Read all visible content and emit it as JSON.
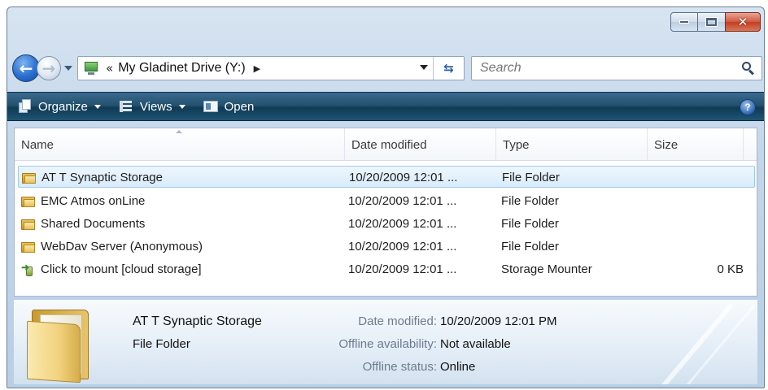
{
  "window": {
    "caption": {
      "minimize_icon": "minimize-icon",
      "maximize_icon": "maximize-icon",
      "close_glyph": "✕"
    }
  },
  "nav": {
    "location": "My Gladinet Drive (Y:)",
    "chevron": "«",
    "breadcrumb_arrow": "▶",
    "search_placeholder": "Search"
  },
  "toolbar": {
    "organize_label": "Organize",
    "views_label": "Views",
    "open_label": "Open",
    "help_label": "?"
  },
  "list": {
    "columns": [
      "Name",
      "Date modified",
      "Type",
      "Size"
    ],
    "rows": [
      {
        "name": "AT T Synaptic Storage",
        "date": "10/20/2009 12:01 ...",
        "type": "File Folder",
        "size": "",
        "icon": "folder-icon",
        "selected": true
      },
      {
        "name": "EMC Atmos onLine",
        "date": "10/20/2009 12:01 ...",
        "type": "File Folder",
        "size": "",
        "icon": "folder-icon",
        "selected": false
      },
      {
        "name": "Shared Documents",
        "date": "10/20/2009 12:01 ...",
        "type": "File Folder",
        "size": "",
        "icon": "folder-icon",
        "selected": false
      },
      {
        "name": "WebDav Server (Anonymous)",
        "date": "10/20/2009 12:01 ...",
        "type": "File Folder",
        "size": "",
        "icon": "folder-icon",
        "selected": false
      },
      {
        "name": "Click to mount [cloud storage]",
        "date": "10/20/2009 12:01 ...",
        "type": "Storage Mounter",
        "size": "0 KB",
        "icon": "mount-icon",
        "selected": false
      }
    ]
  },
  "details": {
    "name": "AT T Synaptic Storage",
    "type": "File Folder",
    "props": [
      {
        "key": "Date modified:",
        "value": "10/20/2009 12:01 PM"
      },
      {
        "key": "Offline availability:",
        "value": "Not available"
      },
      {
        "key": "Offline status:",
        "value": "Online"
      }
    ]
  },
  "colors": {
    "toolbar": "#1f5574",
    "selection": "#d9ecfb",
    "chrome": "#c3d6ea",
    "close": "#c13e22"
  }
}
